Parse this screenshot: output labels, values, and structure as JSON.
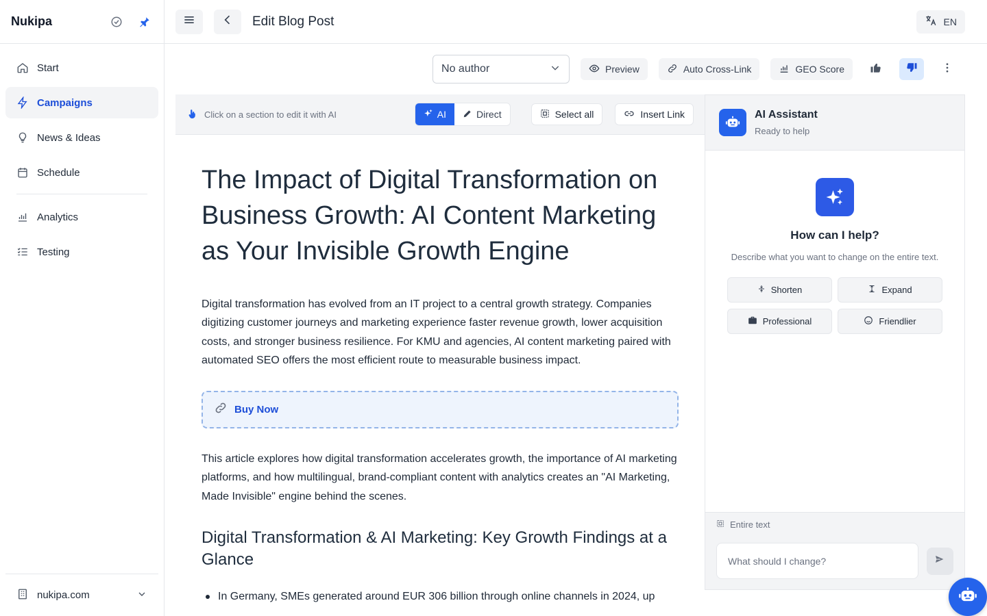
{
  "app": {
    "brand": "Nukipa"
  },
  "sidebar": {
    "items": [
      {
        "label": "Start",
        "icon": "home-icon"
      },
      {
        "label": "Campaigns",
        "icon": "lightning-icon",
        "active": true
      },
      {
        "label": "News & Ideas",
        "icon": "lightbulb-icon"
      },
      {
        "label": "Schedule",
        "icon": "calendar-icon"
      },
      {
        "label": "Analytics",
        "icon": "bar-chart-icon"
      },
      {
        "label": "Testing",
        "icon": "checklist-icon"
      }
    ],
    "workspace": "nukipa.com"
  },
  "topbar": {
    "title": "Edit Blog Post",
    "language": "EN"
  },
  "toolbar": {
    "author_value": "No author",
    "preview_label": "Preview",
    "cross_link_label": "Auto Cross-Link",
    "geo_score_label": "GEO Score"
  },
  "editor": {
    "hint": "Click on a section to edit it with AI",
    "mode_ai": "AI",
    "mode_direct": "Direct",
    "select_all": "Select all",
    "insert_link": "Insert Link",
    "title": "The Impact of Digital Transformation on Business Growth: AI Content Marketing as Your Invisible Growth Engine",
    "intro": "Digital transformation has evolved from an IT project to a central growth strategy. Companies digitizing customer journeys and marketing experience faster revenue growth, lower acquisition costs, and stronger business resilience. For KMU and agencies, AI content marketing paired with automated SEO offers the most efficient route to measurable business impact.",
    "cta_label": "Buy Now",
    "para2": "This article explores how digital transformation accelerates growth, the importance of AI marketing platforms, and how multilingual, brand-compliant content with analytics creates an \"AI Marketing, Made Invisible\" engine behind the scenes.",
    "heading2": "Digital Transformation & AI Marketing: Key Growth Findings at a Glance",
    "bullet1": "In Germany, SMEs generated around EUR 306 billion through online channels in 2024, up"
  },
  "ai": {
    "name": "AI Assistant",
    "status": "Ready to help",
    "question": "How can I help?",
    "description": "Describe what you want to change on the entire text.",
    "actions": [
      {
        "label": "Shorten",
        "icon": "shorten-icon"
      },
      {
        "label": "Expand",
        "icon": "expand-icon"
      },
      {
        "label": "Professional",
        "icon": "briefcase-icon"
      },
      {
        "label": "Friendlier",
        "icon": "smiley-icon"
      }
    ],
    "scope": "Entire text",
    "input_placeholder": "What should I change?"
  },
  "colors": {
    "accent": "#2563eb",
    "active_nav_bg": "#f3f4f6",
    "cta_border": "#93b4e8"
  }
}
